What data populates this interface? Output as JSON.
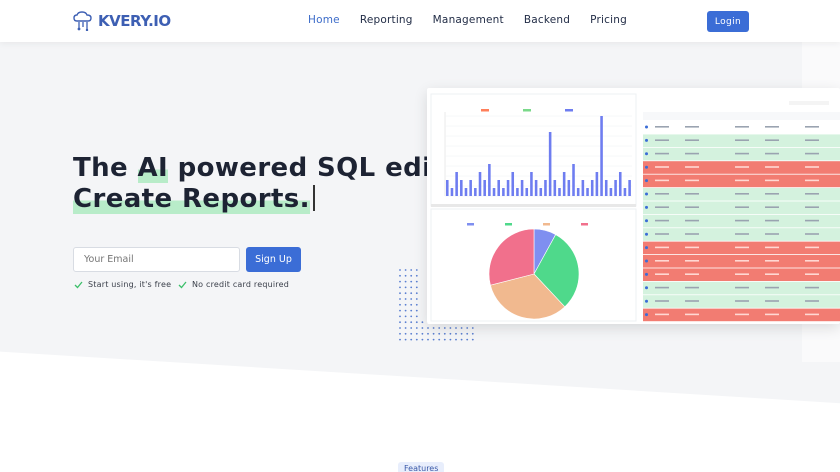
{
  "brand": {
    "name": "KVERY.IO",
    "accent": "#3b6dd6",
    "highlight": "#b8ecc9"
  },
  "nav": {
    "links": [
      "Home",
      "Reporting",
      "Management",
      "Backend",
      "Pricing"
    ],
    "active": "Home",
    "login": "Login"
  },
  "hero": {
    "line1_pre": "The ",
    "line1_hl": "AI",
    "line1_post": " powered SQL editor.",
    "line2": "Create Reports."
  },
  "signup": {
    "email_placeholder": "Your Email",
    "button": "Sign Up",
    "perk1": "Start using, it's free",
    "perk2": "No credit card required"
  },
  "preview": {
    "bar_chart": {
      "type": "bar",
      "legend": [
        "Payment type 1",
        "Payment type 2",
        "Payment type 3"
      ],
      "colors": [
        "#ff7f5a",
        "#7ad98a",
        "#6e7df0"
      ],
      "values": [
        2,
        1,
        3,
        2,
        1,
        2,
        1,
        3,
        2,
        4,
        1,
        2,
        1,
        2,
        3,
        1,
        2,
        1,
        3,
        2,
        1,
        2,
        8,
        2,
        1,
        3,
        2,
        4,
        1,
        2,
        1,
        2,
        3,
        10,
        2,
        1,
        2,
        3,
        1,
        2
      ]
    },
    "pie_chart": {
      "type": "pie",
      "legend": [
        "Customer - 8%",
        "Customer - 30%",
        "Customer - 33%",
        "Customer - 29%"
      ],
      "values": [
        8,
        30,
        33,
        29
      ],
      "colors": [
        "#7f8ff0",
        "#4fd98b",
        "#f1b98f",
        "#f1708c"
      ]
    },
    "table": {
      "headers": [
        "customerNumber",
        "customerName",
        "contactLastName",
        "contactFirstName",
        "phone"
      ],
      "row_status": [
        "blue",
        "green",
        "green",
        "red",
        "red",
        "green",
        "green",
        "green",
        "green",
        "red",
        "red",
        "red",
        "green",
        "green",
        "red"
      ]
    }
  },
  "features": {
    "label": "Features"
  }
}
